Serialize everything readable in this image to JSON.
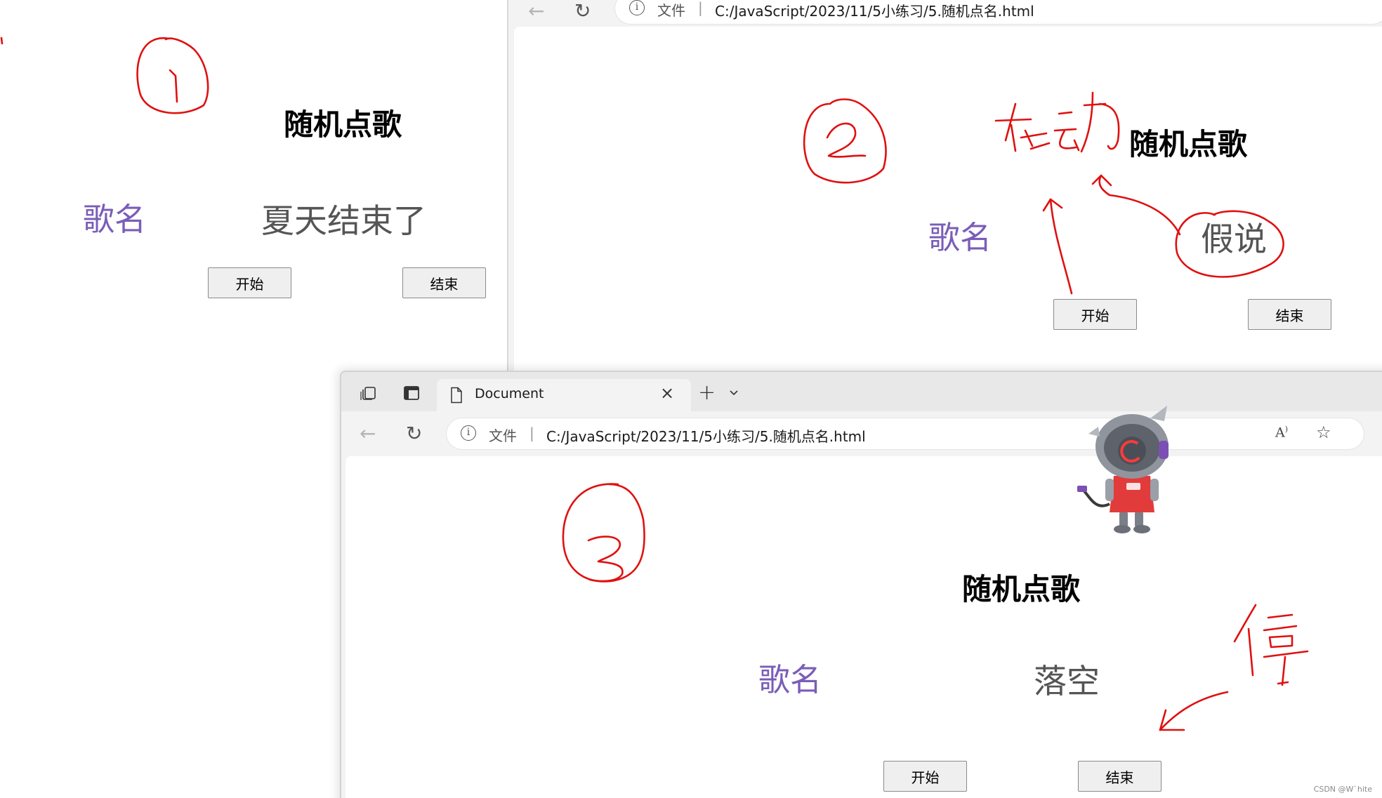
{
  "common": {
    "url_info_label": "文件",
    "url": "C:/JavaScript/2023/11/5小练习/5.随机点名.html",
    "page_title": "随机点歌",
    "song_label": "歌名",
    "start_label": "开始",
    "end_label": "结束"
  },
  "screenshot1": {
    "song_name": "夏天结束了",
    "annotation_number": "①"
  },
  "screenshot2": {
    "song_name": "假说",
    "annotation_number": "②",
    "annotation_note": "在动"
  },
  "screenshot3": {
    "tab_title": "Document",
    "song_name": "落空",
    "annotation_number": "③",
    "annotation_note": "停"
  },
  "watermark": "CSDN @W`hite",
  "colors": {
    "song_label": "#7a5db8",
    "song_name": "#555555",
    "annotation": "#e01010"
  },
  "icons": {
    "back": "arrow-left-icon",
    "refresh": "refresh-icon",
    "info": "info-icon",
    "read_aloud": "read-aloud-icon",
    "favorite": "star-icon",
    "collections": "collections-icon",
    "tab_actions": "tab-actions-icon",
    "page": "page-icon",
    "close_tab": "close-icon",
    "new_tab": "plus-icon",
    "tab_dropdown": "chevron-down-icon"
  }
}
